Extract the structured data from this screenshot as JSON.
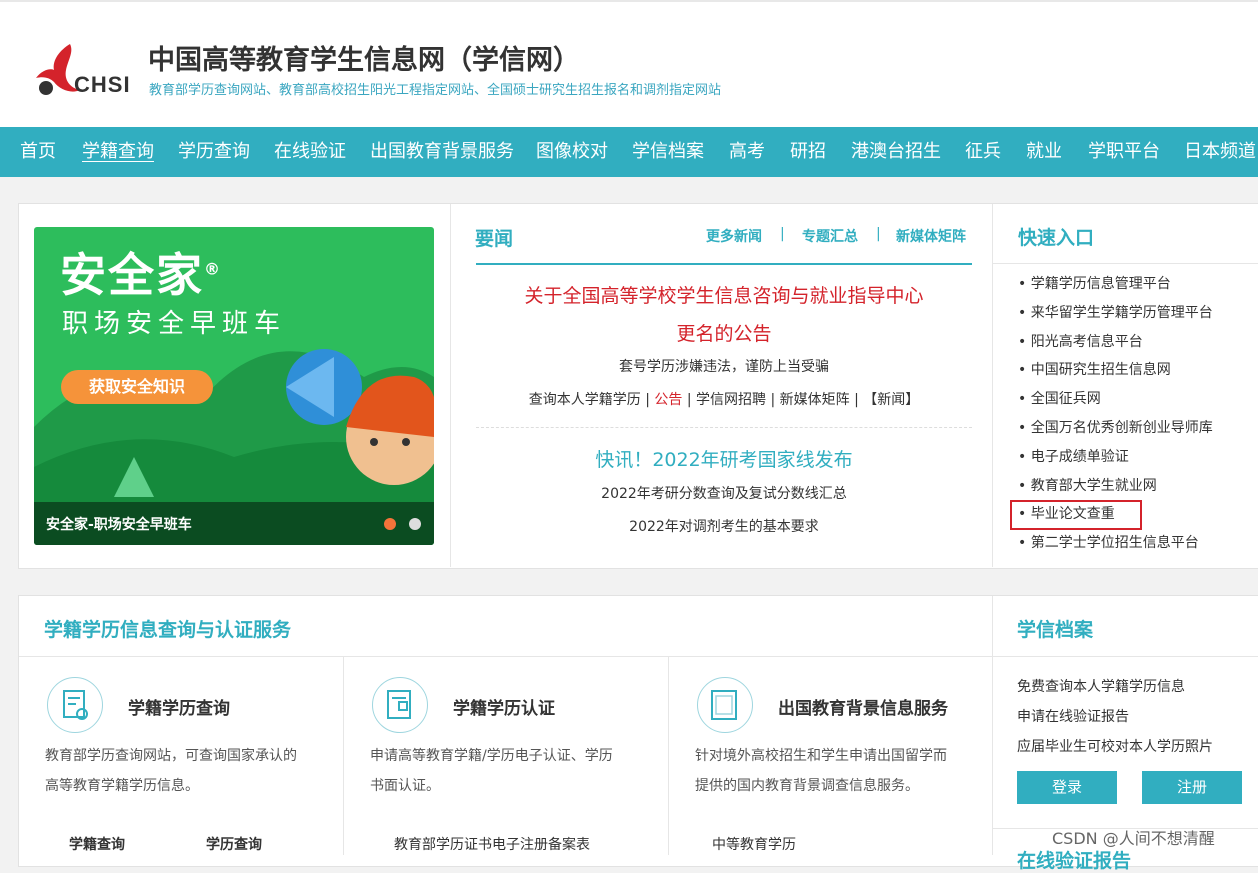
{
  "header": {
    "logo_text": "CHSI",
    "title": "中国高等教育学生信息网（学信网）",
    "subtitle": "教育部学历查询网站、教育部高校招生阳光工程指定网站、全国硕士研究生招生报名和调剂指定网站"
  },
  "nav": {
    "items": [
      "首页",
      "学籍查询",
      "学历查询",
      "在线验证",
      "出国教育背景服务",
      "图像校对",
      "学信档案",
      "高考",
      "研招",
      "港澳台招生",
      "征兵",
      "就业",
      "学职平台",
      "日本频道"
    ],
    "active": "学籍查询"
  },
  "banner": {
    "title": "安全家",
    "reg": "®",
    "slogan": "职场安全早班车",
    "button": "获取安全知识",
    "caption": "安全家-职场安全早班车"
  },
  "news": {
    "heading": "要闻",
    "more": "更多新闻",
    "topics": "专题汇总",
    "media": "新媒体矩阵",
    "sep": "|",
    "headline_line1": "关于全国高等学校学生信息咨询与就业指导中心",
    "headline_line2": "更名的公告",
    "notice": "套号学历涉嫌违法，谨防上当受骗",
    "links": {
      "query": "查询本人学籍学历",
      "announce": "公告",
      "recruit": "学信网招聘",
      "media": "新媒体矩阵",
      "news": "【新闻】",
      "sep": " | "
    },
    "flash": "快讯！2022年研考国家线发布",
    "item1": "2022年考研分数查询及复试分数线汇总",
    "item2": "2022年对调剂考生的基本要求"
  },
  "quick": {
    "heading": "快速入口",
    "items": [
      "学籍学历信息管理平台",
      "来华留学生学籍学历管理平台",
      "阳光高考信息平台",
      "中国研究生招生信息网",
      "全国征兵网",
      "全国万名优秀创新创业导师库",
      "电子成绩单验证",
      "教育部大学生就业网",
      "毕业论文查重",
      "第二学士学位招生信息平台"
    ]
  },
  "services": {
    "heading": "学籍学历信息查询与认证服务",
    "cards": [
      {
        "title": "学籍学历查询",
        "desc1": "教育部学历查询网站，可查询国家承认的",
        "desc2": "高等教育学籍学历信息。",
        "link1": "学籍查询",
        "link2": "学历查询"
      },
      {
        "title": "学籍学历认证",
        "desc1": "申请高等教育学籍/学历电子认证、学历",
        "desc2": "书面认证。",
        "link1": "教育部学历证书电子注册备案表",
        "link2": ""
      },
      {
        "title": "出国教育背景信息服务",
        "desc1": "针对境外高校招生和学生申请出国留学而",
        "desc2": "提供的国内教育背景调查信息服务。",
        "link1": "中等教育学历",
        "link2": ""
      }
    ]
  },
  "archive": {
    "heading": "学信档案",
    "links": [
      "免费查询本人学籍学历信息",
      "申请在线验证报告",
      "应届毕业生可校对本人学历照片"
    ],
    "login": "登录",
    "register": "注册",
    "next_heading": "在线验证报告"
  },
  "watermark": "CSDN @人间不想清醒",
  "colors": {
    "accent": "#31aec0",
    "headline": "#d4232b",
    "highlight_box": "#d4232b"
  }
}
